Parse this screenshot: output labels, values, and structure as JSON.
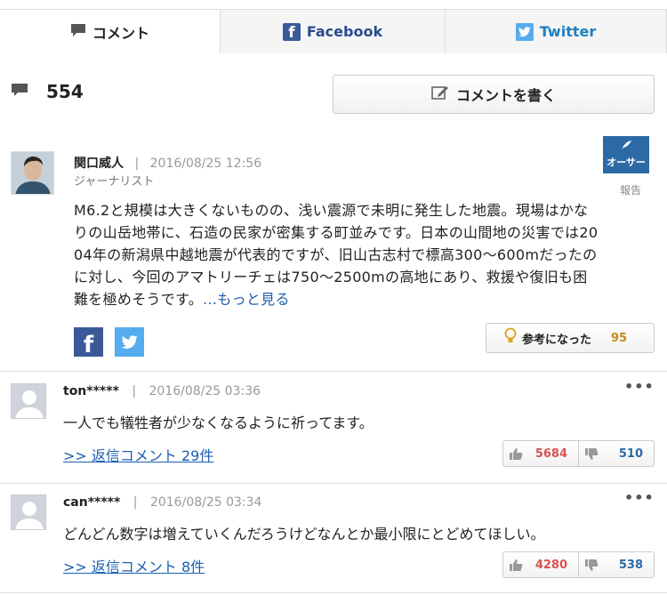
{
  "tabs": [
    {
      "label": "コメント",
      "icon": "speech-bubble-icon",
      "active": true
    },
    {
      "label": "Facebook",
      "icon": "facebook-icon",
      "active": false
    },
    {
      "label": "Twitter",
      "icon": "twitter-icon",
      "active": false
    }
  ],
  "summary": {
    "comment_count": "554",
    "write_button": "コメントを書く"
  },
  "author_comment": {
    "name": "関口威人",
    "separator": "|",
    "timestamp": "2016/08/25 12:56",
    "role": "ジャーナリスト",
    "badge": "オーサー",
    "report_label": "報告",
    "body_lines": [
      "M6.2と規模は大きくないものの、浅い震源で未明に発生した地震。現場はかな",
      "りの山岳地帯に、石造の民家が密集する町並みです。日本の山間地の災害では20",
      "04年の新潟県中越地震が代表的ですが、旧山古志村で標高300〜600mだったの",
      "に対し、今回のアマトリーチェは750〜2500mの高地にあり、救援や復旧も困",
      "難を極めそうです。"
    ],
    "more_link": "...もっと見る",
    "helpful_label": "参考になった",
    "helpful_count": "95"
  },
  "comments": [
    {
      "name": "ton*****",
      "separator": "|",
      "timestamp": "2016/08/25 03:36",
      "menu": "•••",
      "text": "一人でも犠牲者が少なくなるように祈ってます。",
      "replies": ">> 返信コメント 29件",
      "likes": "5684",
      "dislikes": "510"
    },
    {
      "name": "can*****",
      "separator": "|",
      "timestamp": "2016/08/25 03:34",
      "menu": "•••",
      "text": "どんどん数字は増えていくんだろうけどなんとか最小限にとどめてほしい。",
      "replies": ">> 返信コメント 8件",
      "likes": "4280",
      "dislikes": "538"
    }
  ],
  "colors": {
    "link": "#1b5fb0",
    "facebook": "#3b5998",
    "twitter": "#55acee",
    "like": "#d9534f",
    "dislike": "#2c6aa5",
    "helpful": "#c6871b"
  }
}
